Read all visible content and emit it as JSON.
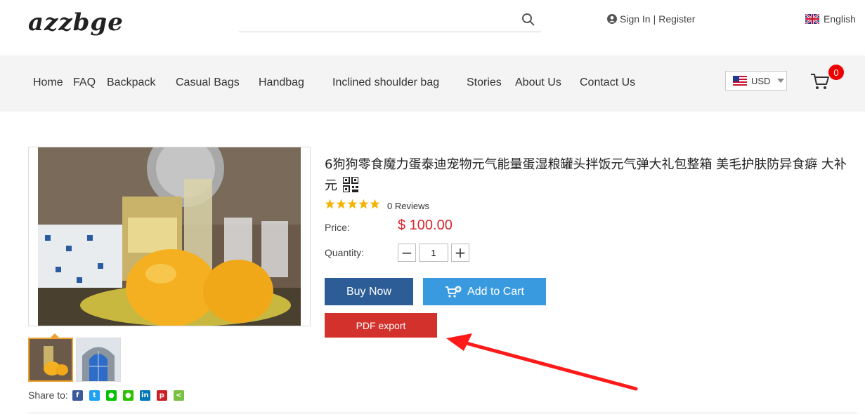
{
  "header": {
    "logo": "azzbge",
    "search": {
      "placeholder": "",
      "value": ""
    },
    "sign_in": "Sign In",
    "separator": "|",
    "register": "Register",
    "language": "English"
  },
  "nav": {
    "items": [
      "Home",
      "FAQ",
      "Backpack",
      "Casual Bags",
      "Handbag",
      "Inclined shoulder bag",
      "Stories",
      "About Us",
      "Contact Us"
    ],
    "currency": "USD",
    "cart_count": "0"
  },
  "product": {
    "title": "6狗狗零食魔力蛋泰迪宠物元气能量蛋湿粮罐头拌饭元气弹大礼包整箱 美毛护肤防异食癖 大补元",
    "rating": 5,
    "reviews": "0 Reviews",
    "price_label": "Price:",
    "price": "$ 100.00",
    "quantity_label": "Quantity:",
    "quantity": "1",
    "buy_now": "Buy Now",
    "add_to_cart": "Add to Cart",
    "pdf_export": "PDF export",
    "share_label": "Share to:",
    "share_icons": [
      "facebook-icon",
      "twitter-icon",
      "line-icon",
      "wechat-icon",
      "linkedin-icon",
      "pinterest-icon",
      "share-icon"
    ]
  },
  "colors": {
    "price": "#d8262c",
    "buy_now": "#2d5d96",
    "add_to_cart": "#3a9ae0",
    "pdf_export": "#d3322c",
    "cart_badge": "#ee0000",
    "annotation_arrow": "#ff0000"
  }
}
